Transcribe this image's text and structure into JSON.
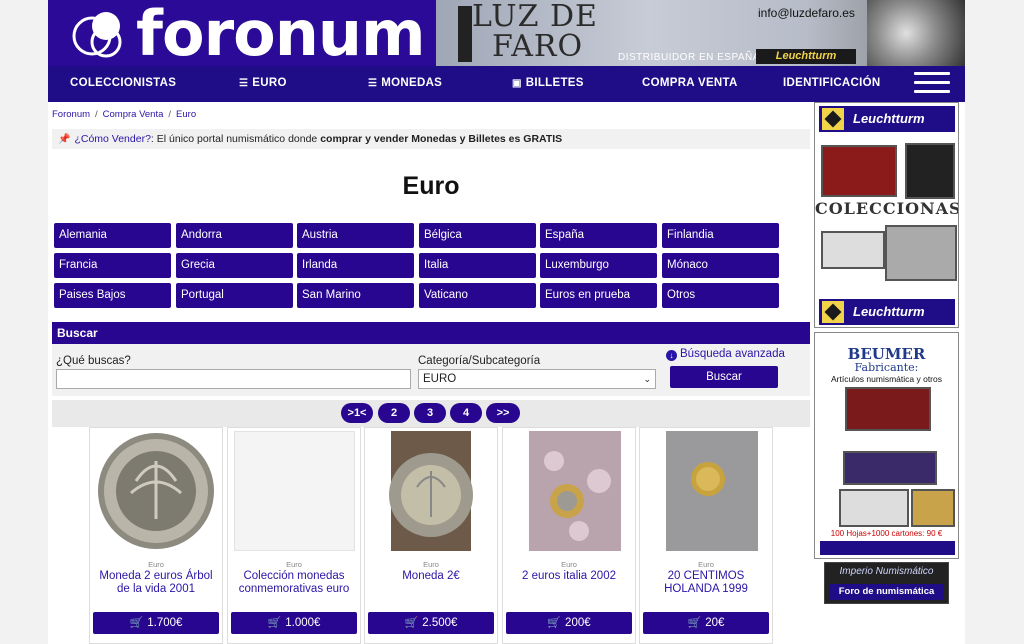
{
  "header": {
    "logo_text": "foronum",
    "banner": {
      "luz": "LUZ DE",
      "faro": "FARO",
      "email": "info@luzdefaro.es",
      "distribuidor": "DISTRIBUIDOR EN ESPAÑA DE",
      "brand": "Leuchtturm"
    }
  },
  "nav": {
    "items": [
      "COLECCIONISTAS",
      "EURO",
      "MONEDAS",
      "BILLETES",
      "COMPRA VENTA",
      "IDENTIFICACIÓN"
    ]
  },
  "breadcrumb": {
    "items": [
      "Foronum",
      "Compra Venta",
      "Euro"
    ]
  },
  "notice": {
    "link": "¿Cómo Vender?",
    "text1": ": El único portal numismático donde ",
    "bold": "comprar y vender Monedas y Billetes es GRATIS"
  },
  "page_title": "Euro",
  "countries": [
    "Alemania",
    "Andorra",
    "Austria",
    "Bélgica",
    "España",
    "Finlandia",
    "Francia",
    "Grecia",
    "Irlanda",
    "Italia",
    "Luxemburgo",
    "Mónaco",
    "Paises Bajos",
    "Portugal",
    "San Marino",
    "Vaticano",
    "Euros en prueba",
    "Otros"
  ],
  "search": {
    "header": "Buscar",
    "query_label": "¿Qué buscas?",
    "query_value": "",
    "category_label": "Categoría/Subcategoría",
    "category_value": "EURO",
    "advanced": "Búsqueda avanzada",
    "button": "Buscar"
  },
  "pagination": [
    ">1<",
    "2",
    "3",
    "4",
    ">>"
  ],
  "products": [
    {
      "category": "Euro",
      "name": "Moneda 2 euros Árbol de la vida 2001",
      "price": "1.700€"
    },
    {
      "category": "Euro",
      "name": "Colección monedas conmemorativas euro",
      "price": "1.000€"
    },
    {
      "category": "Euro",
      "name": "Moneda 2€",
      "price": "2.500€"
    },
    {
      "category": "Euro",
      "name": "2 euros italia 2002",
      "price": "200€"
    },
    {
      "category": "Euro",
      "name": "20 CENTIMOS HOLANDA 1999",
      "price": "20€"
    }
  ],
  "sidebar": {
    "ad1": {
      "brand_top": "Leuchtturm",
      "middle": "COLECCIONAS",
      "brand_bottom": "Leuchtturm"
    },
    "ad2": {
      "brand": "BEUMER",
      "sub": "Fabricante:",
      "desc": "Artículos numismática y otros",
      "price": "100 Hojas+1000 cartones: 90 €"
    },
    "ad3": {
      "title": "Imperio Numismático",
      "sub": "Foro de numismática"
    }
  },
  "colors": {
    "primary": "#28068f",
    "header": "#2a0a96",
    "link": "#2a16a6"
  }
}
